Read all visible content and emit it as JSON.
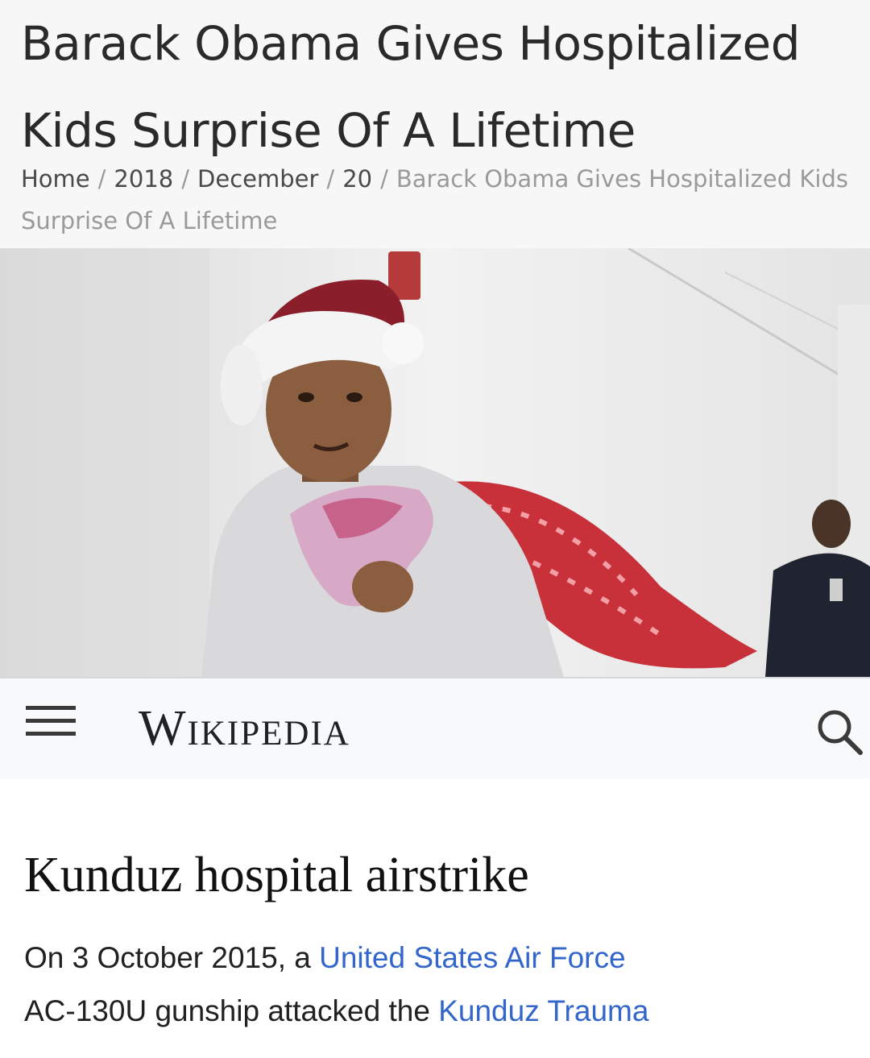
{
  "article": {
    "title": "Barack Obama Gives Hospitalized Kids Surprise Of A Lifetime",
    "breadcrumb": {
      "home": "Home",
      "year": "2018",
      "month": "December",
      "day": "20",
      "current": "Barack Obama Gives Hospitalized Kids Surprise Of A Lifetime",
      "separator": "/"
    }
  },
  "photo": {
    "subject_icon": "person-santa-hat-icon"
  },
  "wikipedia": {
    "logo": "Wikipedia",
    "menu_icon": "hamburger-menu-icon",
    "search_icon": "search-icon",
    "page_title": "Kunduz hospital airstrike",
    "summary": {
      "part1": "On 3 October 2015, a ",
      "link1": "United States Air Force",
      "part2": "AC-130U gunship attacked the ",
      "link2": "Kunduz Trauma"
    },
    "colors": {
      "link": "#3366cc",
      "header_bg": "#f8f9fa"
    }
  }
}
